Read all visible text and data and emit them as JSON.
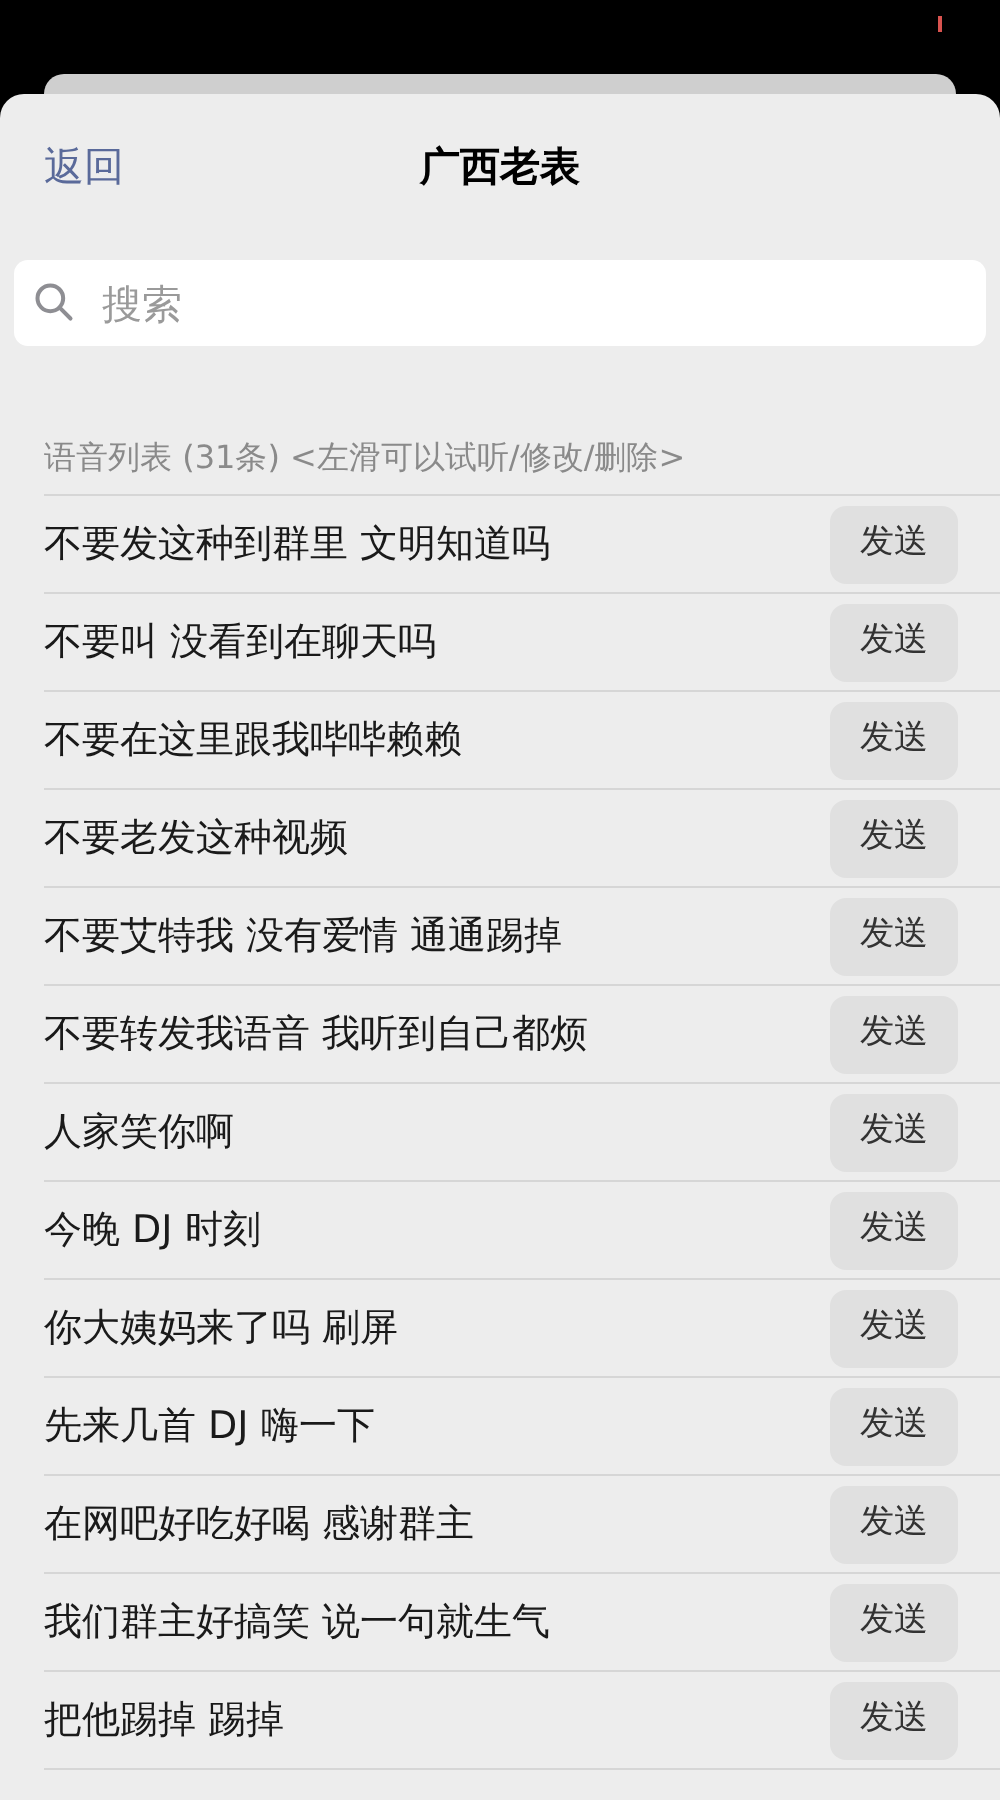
{
  "header": {
    "back": "返回",
    "title": "广西老表"
  },
  "search": {
    "placeholder": "搜索"
  },
  "section_title": "语音列表 (31条) <左滑可以试听/修改/删除>",
  "items": [
    {
      "text": "不要发这种到群里 文明知道吗",
      "action": "发送"
    },
    {
      "text": "不要叫 没看到在聊天吗",
      "action": "发送"
    },
    {
      "text": "不要在这里跟我哔哔赖赖",
      "action": "发送"
    },
    {
      "text": "不要老发这种视频",
      "action": "发送"
    },
    {
      "text": "不要艾特我 没有爱情 通通踢掉",
      "action": "发送"
    },
    {
      "text": "不要转发我语音 我听到自己都烦",
      "action": "发送"
    },
    {
      "text": "人家笑你啊",
      "action": "发送"
    },
    {
      "text": "今晚 DJ 时刻",
      "action": "发送"
    },
    {
      "text": "你大姨妈来了吗 刷屏",
      "action": "发送"
    },
    {
      "text": "先来几首 DJ 嗨一下",
      "action": "发送"
    },
    {
      "text": "在网吧好吃好喝 感谢群主",
      "action": "发送"
    },
    {
      "text": "我们群主好搞笑 说一句就生气",
      "action": "发送"
    },
    {
      "text": "把他踢掉 踢掉",
      "action": "发送"
    }
  ]
}
